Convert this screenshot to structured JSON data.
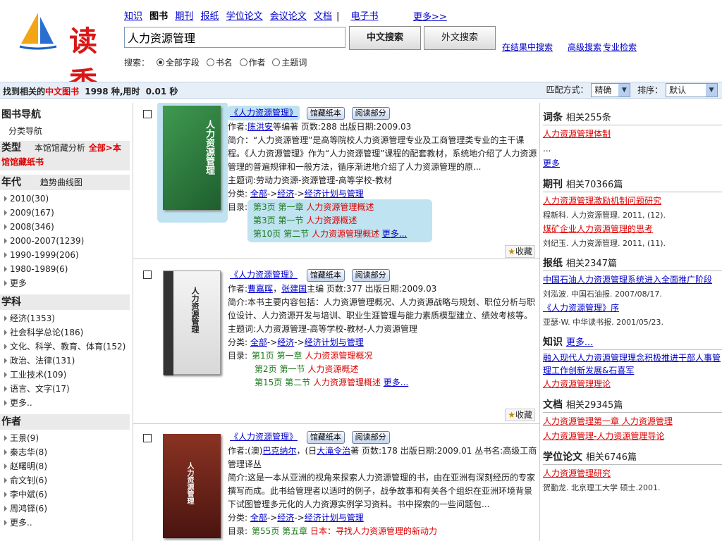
{
  "header": {
    "logo_text": "读秀",
    "type_tabs": [
      "知识",
      "图书",
      "期刊",
      "报纸",
      "学位论文",
      "会议论文",
      "文档",
      "电子书"
    ],
    "current_tab": "图书",
    "more": "更多>>",
    "search_value": "人力资源管理",
    "btn_cn": "中文搜索",
    "btn_en": "外文搜索",
    "in_results": "在结果中搜索",
    "advanced": "高级搜索",
    "professional": "专业检索",
    "search_label": "搜索：",
    "options": [
      "全部字段",
      "书名",
      "作者",
      "主题词"
    ],
    "selected_option": "全部字段"
  },
  "status": {
    "prefix": "找到相关的",
    "kind": "中文图书",
    "count": "1998",
    "mid": "种,用时",
    "time": "0.01",
    "unit": "秒",
    "match_label": "匹配方式：",
    "match_value": "精确",
    "sort_label": "排序：",
    "sort_value": "默认"
  },
  "sidebar": {
    "nav_title": "图书导航",
    "nav_sub": "分类导航",
    "type_title": "类型",
    "type_local": "本馆馆藏分析",
    "type_all": "全部>本",
    "type_paper": "馆馆藏纸书",
    "year_title": "年代",
    "year_trend": "趋势曲线图",
    "years": [
      "2010(30)",
      "2009(167)",
      "2008(346)",
      "2000-2007(1239)",
      "1990-1999(206)",
      "1980-1989(6)",
      "更多"
    ],
    "subject_title": "学科",
    "subjects": [
      "经济(1353)",
      "社会科学总论(186)",
      "文化、科学、教育、体育(152)",
      "政治、法律(131)",
      "工业技术(109)",
      "语言、文字(17)",
      "更多.."
    ],
    "author_title": "作者",
    "authors": [
      "王景(9)",
      "秦志华(8)",
      "赵曙明(8)",
      "俞文钊(6)",
      "李中斌(6)",
      "周鸿铎(6)",
      "更多.."
    ]
  },
  "results": [
    {
      "title": "《人力资源管理》",
      "btn_paper": "馆藏纸本",
      "btn_read": "阅读部分",
      "author_label": "作者:",
      "author": "陈洪安",
      "author_suffix": "等编著  页数:288  出版日期:2009.03",
      "summary": "简介：“人力资源管理”是高等院校人力资源管理专业及工商管理类专业的主干课程。《人力资源管理》作为“人力资源管理”课程的配套教材，系统地介绍了人力资源管理的普遍规律和一般方法，循序渐进地介绍了人力资源管理的原...",
      "subject": "主题词:劳动力资源-资源管理-高等学校-教材",
      "cat_label": "分类:",
      "cats": [
        "全部",
        "经济",
        "经济计划与管理"
      ],
      "toc_label": "目录:",
      "toc": [
        {
          "page": "第3页",
          "sec": "第一章",
          "text": "人力资源管理概述"
        },
        {
          "page": "第3页",
          "sec": "第一节",
          "text": "人力资源概述"
        },
        {
          "page": "第10页",
          "sec": "第二节",
          "text": "人力资源管理概述"
        }
      ],
      "more": "更多...",
      "fav": "收藏",
      "cover_title": "人力资源管理",
      "cover_color": "#2d7a3e"
    },
    {
      "title": "《人力资源管理》",
      "btn_paper": "馆藏纸本",
      "btn_read": "阅读部分",
      "author_label": "作者:",
      "author": "曹嘉晖",
      "author2": "张建国",
      "author_suffix": "主编  页数:377  出版日期:2009.03",
      "summary": "简介:本书主要内容包括：人力资源管理概况、人力资源战略与规划、职位分析与职位设计、人力资源开发与培训、职业生涯管理与能力素质模型建立、绩效考核等。",
      "subject": "主题词:人力资源管理-高等学校-教材-人力资源管理",
      "cat_label": "分类:",
      "cats": [
        "全部",
        "经济",
        "经济计划与管理"
      ],
      "toc_label": "目录:",
      "toc": [
        {
          "page": "第1页",
          "sec": "第一章",
          "text": "人力资源管理概况"
        },
        {
          "page": "第2页",
          "sec": "第一节",
          "text": "人力资源概述"
        },
        {
          "page": "第15页",
          "sec": "第二节",
          "text": "人力资源管理概述"
        }
      ],
      "more": "更多...",
      "fav": "收藏",
      "cover_title": "人力资源管理",
      "cover_color": "#e8e8e8"
    },
    {
      "title": "《人力资源管理》",
      "btn_paper": "馆藏纸本",
      "btn_read": "阅读部分",
      "author_label": "作者:",
      "author_pre": "(澳)",
      "author": "巴克纳尔",
      "author_mid": "，(日",
      "author2": "大滝令治",
      "author_suffix": "著  页数:178  出版日期:2009.01  丛书名:高级工商管理译丛",
      "summary": "简介:这是一本从亚洲的视角来探索人力资源管理的书，由在亚洲有深刻经历的专家撰写而成。此书给管理者以适时的例子，战争故事和有关各个组织在亚洲环境背景下试图管理多元化的人力资源实例学习资料。书中探索的一些问题包...",
      "cat_label": "分类:",
      "cats": [
        "全部",
        "经济",
        "经济计划与管理"
      ],
      "toc_label": "目录:",
      "toc": [
        {
          "page": "第55页",
          "sec": "第五章",
          "text": "日本：寻找人力资源管理的新动力"
        }
      ],
      "cover_title": "人力资源管理",
      "cover_color": "#6b2418"
    }
  ],
  "right": {
    "ci_title": "词条",
    "ci_count": "相关255条",
    "ci_items": [
      "人力资源管理体制",
      "...",
      "更多"
    ],
    "qk_title": "期刊",
    "qk_count": "相关70366篇",
    "qk_items": [
      {
        "t": "人力资源管理激励机制问题研究",
        "s": "程新科. 人力资源管理. 2011, (12)."
      },
      {
        "t": "煤矿企业人力资源管理的思考",
        "s": "刘纪玉. 人力资源管理. 2011, (11)."
      }
    ],
    "bz_title": "报纸",
    "bz_count": "相关2347篇",
    "bz_items": [
      {
        "t": "中国石油人力资源管理系统进入全面推广阶段",
        "s": "刘泓波. 中国石油报. 2007/08/17."
      },
      {
        "t": "《人力资源管理》序",
        "s": "亚瑟·W. 中华读书报. 2001/05/23."
      }
    ],
    "zs_title": "知识",
    "zs_more": "更多...",
    "zs_items": [
      "融入现代人力资源管理理念积极推进干部人事管理工作创新发展&石喜军",
      "人力资源管理理论"
    ],
    "wd_title": "文档",
    "wd_count": "相关29345篇",
    "wd_items": [
      "人力资源管理第一章 人力资源管理",
      "人力资源管理-人力资源管理导论"
    ],
    "xw_title": "学位论文",
    "xw_count": "相关6746篇",
    "xw_items": [
      {
        "t": "人力资源管理研究",
        "s": "贺勤龙. 北京理工大学  硕士.2001."
      }
    ]
  }
}
